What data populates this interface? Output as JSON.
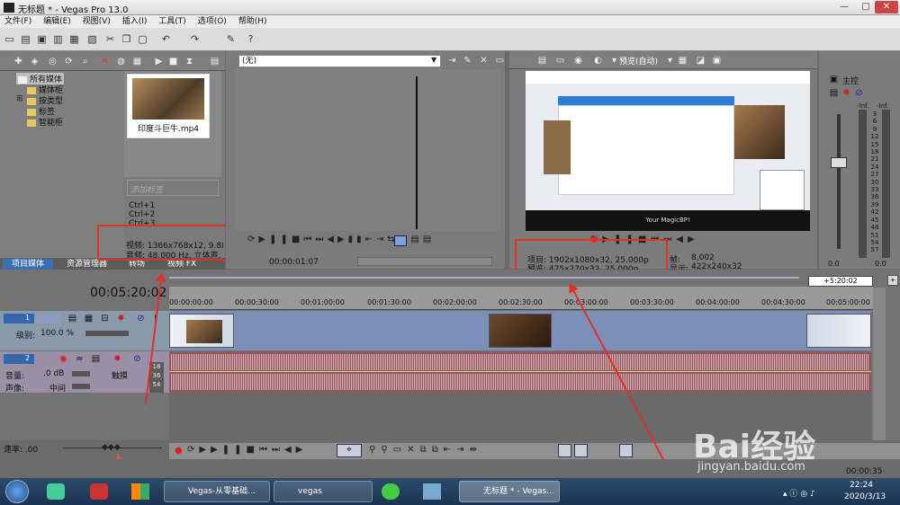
{
  "window": {
    "title": "无标题 * - Vegas Pro 13.0"
  },
  "menu": [
    "文件(F)",
    "编辑(E)",
    "视图(V)",
    "插入(I)",
    "工具(T)",
    "选项(O)",
    "帮助(H)"
  ],
  "explorer": {
    "tree": [
      "所有媒体",
      "媒体柜",
      "按类型",
      "标签",
      "智能柜"
    ],
    "thumb_caption": "印度斗巨牛.mp4",
    "tag_placeholder": "添加标签",
    "shortcuts": [
      "Ctrl+1",
      "Ctrl+2",
      "Ctrl+3"
    ],
    "video_info": "视频: 1366x768x12, 9.886",
    "audio_info": "音频: 48,000 Hz, 立体声,",
    "tabs": [
      "项目媒体",
      "资源管理器",
      "转场",
      "视频 FX"
    ]
  },
  "trimmer": {
    "dropdown": "(无)",
    "timecode": "00:00:01:07"
  },
  "preview": {
    "mode": "预览(自动)",
    "project_info": "项目: 1902x1080x32, 25.000p",
    "preview_info": "预览: 475x270x32, 25.000p",
    "frame_label": "帧:",
    "frame_value": "8,002",
    "display_label": "显示:",
    "display_value": "422x240x32",
    "screen_caption": "Your MagicBP!"
  },
  "mixer": {
    "title": "主控",
    "db_top": [
      "-Inf.",
      "-Inf."
    ],
    "scale": [
      "3",
      "6",
      "9",
      "12",
      "15",
      "18",
      "21",
      "24",
      "27",
      "30",
      "33",
      "36",
      "39",
      "42",
      "45",
      "48",
      "51",
      "54",
      "57"
    ],
    "bottom": [
      "0.0",
      "0.0"
    ]
  },
  "timeline": {
    "timecode": "00:05:20:02",
    "end_marker": "+5:20:02",
    "ticks": [
      "00:00:00:00",
      "00:00:30:00",
      "00:01:00:00",
      "00:01:30:00",
      "00:02:00:00",
      "00:02:30:00",
      "00:03:00:00",
      "00:03:30:00",
      "00:04:00:00",
      "00:04:30:00",
      "00:05:00:00"
    ],
    "video_track": {
      "num": "1",
      "level_label": "级别:",
      "level_value": "100.0 %"
    },
    "audio_track": {
      "num": "2",
      "vol_label": "音量:",
      "vol_value": ".0 dB",
      "pan_label": "声像:",
      "pan_value": "中间",
      "touch": "触摸",
      "meter": [
        "18",
        "36",
        "54"
      ]
    },
    "rate": "速率: .00",
    "end_time": "00:00:35"
  },
  "taskbar": {
    "items": [
      "Vegas-从零基础...",
      "vegas",
      "无标题 * - Vegas..."
    ],
    "time": "22:24",
    "date": "2020/3/13"
  },
  "watermark": {
    "brand": "Bai经验",
    "url": "jingyan.baidu.com"
  },
  "colors": {
    "highlight": "#e0302a",
    "video_track": "#7b8fb8",
    "audio_track": "#8e5a62"
  }
}
